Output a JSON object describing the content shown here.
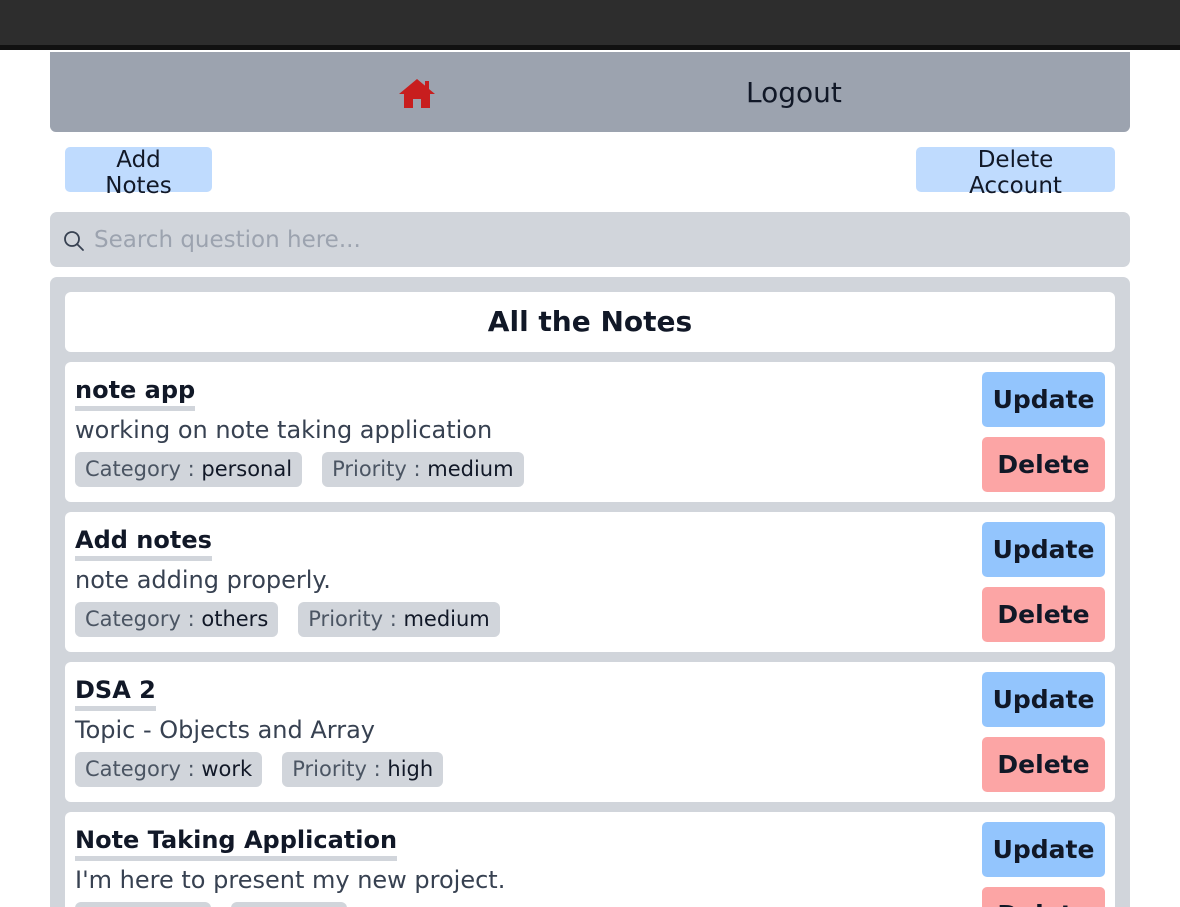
{
  "nav": {
    "home_icon": "home-icon",
    "logout_label": "Logout"
  },
  "toolbar": {
    "add_notes_label": "Add Notes",
    "delete_account_label": "Delete Account"
  },
  "search": {
    "placeholder": "Search question here...",
    "value": ""
  },
  "panel": {
    "title": "All the Notes"
  },
  "labels": {
    "category": "Category",
    "priority": "Priority",
    "separator": " : ",
    "update": "Update",
    "delete": "Delete"
  },
  "colors": {
    "home_icon": "#c81e1e",
    "update_button": "#93c5fd",
    "delete_button": "#fca5a5",
    "secondary_button": "#bfdbfe"
  },
  "notes": [
    {
      "title": "note app",
      "description": "working on note taking application",
      "category": "personal",
      "priority": "medium"
    },
    {
      "title": "Add notes",
      "description": "note adding properly.",
      "category": "others",
      "priority": "medium"
    },
    {
      "title": "DSA 2",
      "description": "Topic - Objects and Array",
      "category": "work",
      "priority": "high"
    },
    {
      "title": "Note Taking Application",
      "description": "I'm here to present my new project.",
      "category": "",
      "priority": ""
    }
  ]
}
